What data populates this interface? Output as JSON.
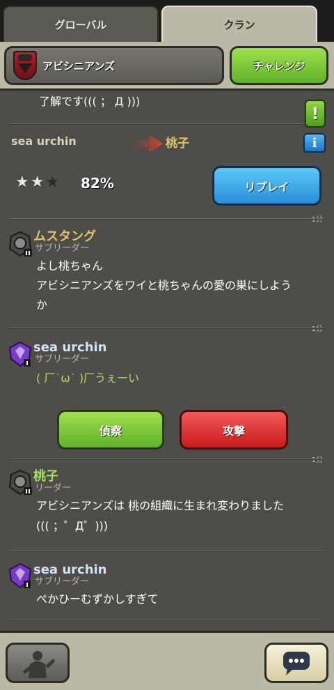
{
  "tabs": {
    "global": "グローバル",
    "clan": "クラン"
  },
  "header": {
    "clan_name": "アビシニアンズ",
    "challenge_label": "チャレンジ"
  },
  "chat": {
    "partial_message": "了解です((( ； Д )))",
    "warlog": {
      "attacker": "sea urchin",
      "defender": "桃子",
      "stars": 2,
      "stars_max": 3,
      "percent": "82%",
      "replay_label": "リプレイ",
      "timestamp": "1分"
    },
    "messages": [
      {
        "sender": "ムスタング",
        "role": "サブリーダー",
        "lines": [
          "よし桃ちゃん",
          "アビシニアンズをワイと桃ちゃんの愛の巣にしよう",
          "か"
        ],
        "timestamp": "1分"
      },
      {
        "sender": "sea urchin",
        "role": "サブリーダー",
        "lines": [
          "( 厂˙ω˙ )厂うぇーい"
        ],
        "timestamp": "1分"
      },
      {
        "sender": "桃子",
        "role": "リーダー",
        "lines": [
          "アビシニアンズは 桃の組織に生まれ変わりました",
          "((( ；゜Д゜)))"
        ]
      },
      {
        "sender": "sea urchin",
        "role": "サブリーダー",
        "lines": [
          "ぺかひーむずかしすぎて"
        ]
      }
    ],
    "war_buttons": {
      "scout": "偵察",
      "attack": "攻撃"
    }
  },
  "icons": {
    "alert": "exclamation-icon",
    "info": "info-icon",
    "arrow": "attack-arrow-icon",
    "footer_left": "emote-icon",
    "footer_right": "chat-bubble-icon"
  },
  "colors": {
    "challenge": "#6cc02e",
    "replay": "#3aa0e8",
    "scout": "#6cc02e",
    "attack": "#d82a2a",
    "background": "#4e4d4a"
  }
}
